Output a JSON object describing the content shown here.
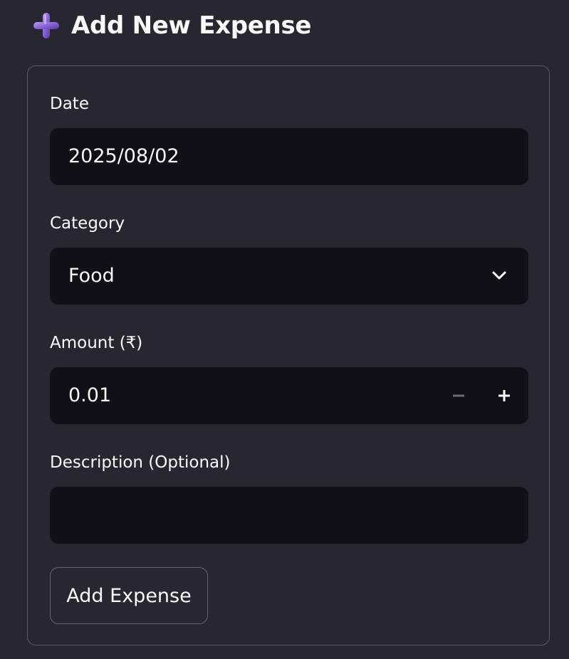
{
  "header": {
    "icon": "heavy-plus-emoji",
    "title": "Add New Expense"
  },
  "form": {
    "date": {
      "label": "Date",
      "value": "2025/08/02"
    },
    "category": {
      "label": "Category",
      "value": "Food",
      "icon": "chevron-down-icon"
    },
    "amount": {
      "label": "Amount (₹)",
      "value": "0.01",
      "decrement_icon": "minus-icon",
      "increment_icon": "plus-icon"
    },
    "description": {
      "label": "Description (Optional)",
      "value": ""
    },
    "submit_label": "Add Expense"
  },
  "colors": {
    "background": "#262730",
    "input_background": "#0e1117",
    "text": "#fafafa",
    "emoji_purple": "#8a63d2",
    "disabled_step": "#6b6d76"
  }
}
